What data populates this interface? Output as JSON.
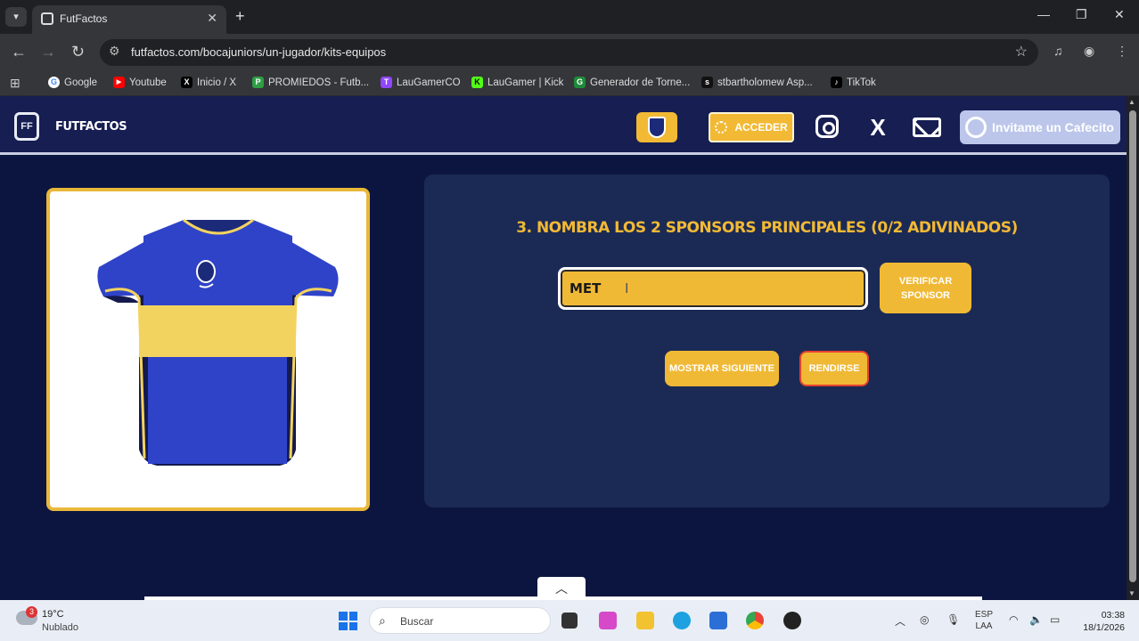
{
  "browser": {
    "tab_title": "FutFactos",
    "url": "futfactos.com/bocajuniors/un-jugador/kits-equipos",
    "bookmarks": [
      {
        "label": "Google",
        "color": "#4285f4",
        "icon": "G"
      },
      {
        "label": "Youtube",
        "color": "#ff0000",
        "icon": "▶"
      },
      {
        "label": "Inicio / X",
        "color": "#000000",
        "icon": "X"
      },
      {
        "label": "PROMIEDOS - Futb...",
        "color": "#2e9e44",
        "icon": "P"
      },
      {
        "label": "LauGamerCO",
        "color": "#9146ff",
        "icon": "T"
      },
      {
        "label": "LauGamer | Kick",
        "color": "#53fc18",
        "icon": "K"
      },
      {
        "label": "Generador de Torne...",
        "color": "#1f8b3a",
        "icon": "G"
      },
      {
        "label": "stbartholomew Asp...",
        "color": "#111111",
        "icon": "s"
      },
      {
        "label": "TikTok",
        "color": "#000000",
        "icon": "♪"
      }
    ]
  },
  "site": {
    "logo_text": "FUTFACTOS",
    "acceder_label": "ACCEDER",
    "cafe_label": "Invitame un Cafecito",
    "question": "3. NOMBRA LOS 2 SPONSORS PRINCIPALES (0/2 ADIVINADOS)",
    "answer_value": "MET",
    "verify_label": "VERIFICAR SPONSOR",
    "next_label": "MOSTRAR SIGUIENTE",
    "giveup_label": "RENDIRSE",
    "accent": "#f0b935",
    "shirt_colors": {
      "blue": "#2f43c9",
      "navy": "#141a4d",
      "gold": "#f3d35f"
    }
  },
  "taskbar": {
    "weather_badge": "3",
    "temperature": "19°C",
    "weather": "Nublado",
    "search_placeholder": "Buscar",
    "lang_top": "ESP",
    "lang_bottom": "LAA",
    "time": "03:38",
    "date": "18/1/2026"
  }
}
